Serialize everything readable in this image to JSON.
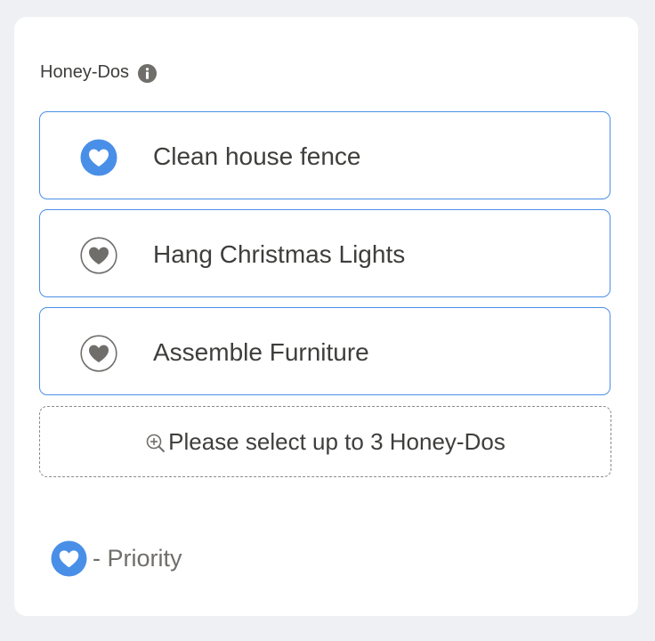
{
  "field": {
    "label": "Honey-Dos",
    "info_icon": "info-icon"
  },
  "items": [
    {
      "label": "Clean house fence",
      "priority": true,
      "icon": "heart-filled-icon"
    },
    {
      "label": "Hang Christmas Lights",
      "priority": false,
      "icon": "heart-outline-icon"
    },
    {
      "label": "Assemble Furniture",
      "priority": false,
      "icon": "heart-outline-icon"
    }
  ],
  "add_slot": {
    "text": "Please select up to 3 Honey-Dos",
    "icon": "zoom-in-icon"
  },
  "legend": {
    "text": "- Priority",
    "icon": "heart-filled-icon"
  },
  "colors": {
    "accent": "#4a8fe7",
    "heart_priority": "#4a8fe7",
    "heart_normal": "#706e6b",
    "text": "#3e3e3c",
    "muted": "#706e6b",
    "card_background": "#ffffff",
    "page_background": "#eef0f3"
  }
}
